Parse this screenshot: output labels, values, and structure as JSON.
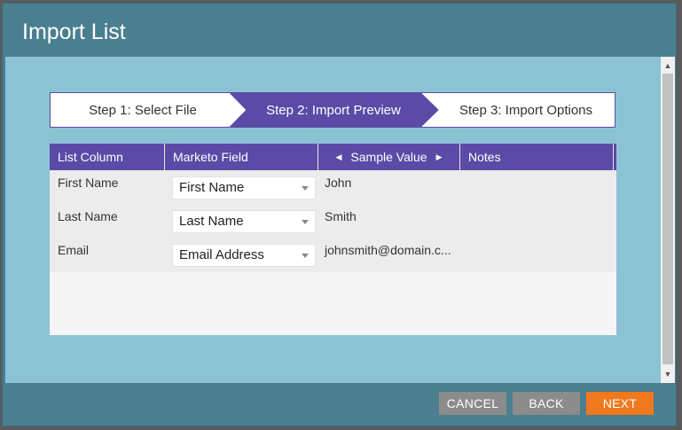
{
  "dialog": {
    "title": "Import List"
  },
  "steps": [
    {
      "label": "Step 1: Select File",
      "active": false
    },
    {
      "label": "Step 2: Import Preview",
      "active": true
    },
    {
      "label": "Step 3: Import Options",
      "active": false
    }
  ],
  "table": {
    "headers": {
      "list_column": "List Column",
      "marketo_field": "Marketo Field",
      "sample_value": "Sample Value",
      "notes": "Notes"
    },
    "rows": [
      {
        "list_column": "First Name",
        "marketo_field": "First Name",
        "sample_value": "John",
        "notes": ""
      },
      {
        "list_column": "Last Name",
        "marketo_field": "Last Name",
        "sample_value": "Smith",
        "notes": ""
      },
      {
        "list_column": "Email",
        "marketo_field": "Email Address",
        "sample_value": "johnsmith@domain.c...",
        "notes": ""
      }
    ]
  },
  "footer": {
    "cancel_label": "CANCEL",
    "back_label": "BACK",
    "next_label": "NEXT"
  },
  "icons": {
    "prev_column": "caret-left-icon",
    "next_column": "caret-right-icon",
    "dropdown": "chevron-down-icon",
    "scroll_up": "triangle-up-icon",
    "scroll_down": "triangle-down-icon"
  },
  "colors": {
    "header_bar": "#4a7f8f",
    "body_bg": "#8bc3d4",
    "active_step": "#5b4aa6",
    "table_header": "#5b4aa6",
    "next_button": "#f0781e",
    "secondary_button": "#8c8c8c"
  }
}
